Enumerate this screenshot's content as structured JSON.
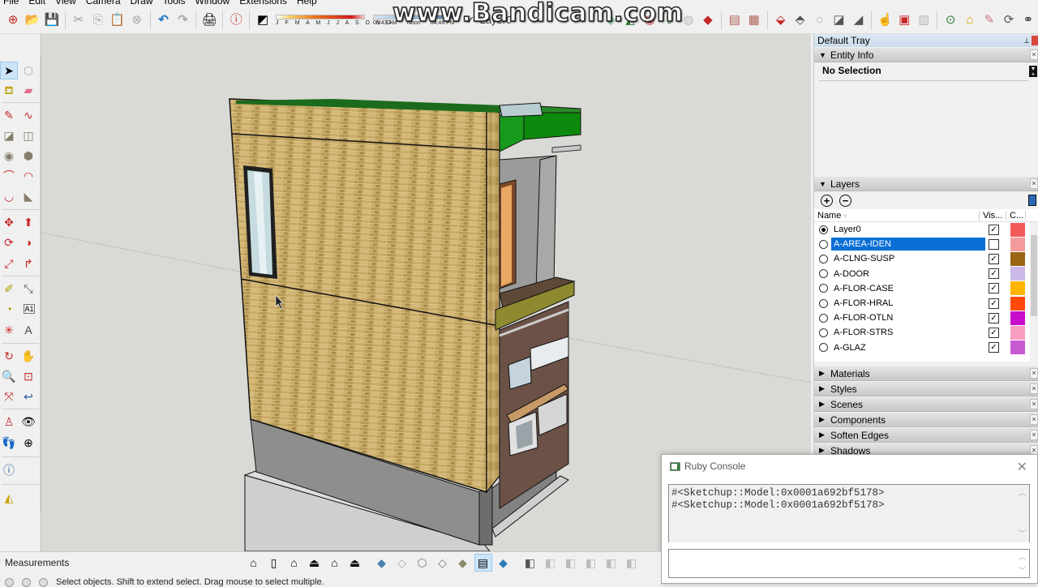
{
  "menu": [
    "File",
    "Edit",
    "View",
    "Camera",
    "Draw",
    "Tools",
    "Window",
    "Extensions",
    "Help"
  ],
  "watermark": "www.Bandicam.com",
  "toolbar": {
    "icons": [
      "new-file",
      "open-file",
      "save",
      "cut",
      "copy",
      "paste",
      "erase",
      "undo",
      "redo",
      "print",
      "model-info",
      "shadows"
    ],
    "shadow_months": "J F M A M J J A S O N D",
    "shadow_times": [
      "06:43 AM",
      "Noon",
      "04:46 PM"
    ],
    "current_layer": "Layer0",
    "right_icons": [
      "sandbox-from-contours",
      "sandbox-from-scratch",
      "smoove",
      "stamp",
      "drape",
      "add-detail",
      "flip-edge",
      "interact",
      "dynamic-components-options",
      "dynamic-components-attributes",
      "3d-warehouse",
      "share-model",
      "extension-warehouse",
      "extension-manager",
      "preview-google-earth"
    ]
  },
  "left_toolbar": {
    "tools": [
      "select",
      "make-component",
      "paint-bucket",
      "eraser",
      "line",
      "freehand",
      "rectangle",
      "rotated-rectangle",
      "circle",
      "polygon",
      "arc",
      "three-point-arc",
      "two-point-arc",
      "pie",
      "move",
      "push-pull",
      "rotate",
      "follow-me",
      "scale",
      "offset",
      "tape-measure",
      "dimension",
      "protractor",
      "text",
      "axes",
      "3d-text",
      "orbit",
      "pan",
      "zoom",
      "zoom-window",
      "zoom-extents",
      "previous-view",
      "position-camera",
      "look-around",
      "walk",
      "section-plane",
      "model-info",
      "mirror"
    ]
  },
  "tray": {
    "title": "Default Tray",
    "entity_info": {
      "label": "Entity Info",
      "status": "No Selection"
    },
    "layers": {
      "label": "Layers",
      "columns": [
        "Name",
        "Vis...",
        "C..."
      ],
      "rows": [
        {
          "name": "Layer0",
          "active": true,
          "visible": true,
          "color": "#f25a5a",
          "selected": false
        },
        {
          "name": "A-AREA-IDEN",
          "active": false,
          "visible": false,
          "color": "#f59a9a",
          "selected": true
        },
        {
          "name": "A-CLNG-SUSP",
          "active": false,
          "visible": true,
          "color": "#9a6414",
          "selected": false
        },
        {
          "name": "A-DOOR",
          "active": false,
          "visible": true,
          "color": "#c9b8e8",
          "selected": false
        },
        {
          "name": "A-FLOR-CASE",
          "active": false,
          "visible": true,
          "color": "#ffb400",
          "selected": false
        },
        {
          "name": "A-FLOR-HRAL",
          "active": false,
          "visible": true,
          "color": "#ff4a0a",
          "selected": false
        },
        {
          "name": "A-FLOR-OTLN",
          "active": false,
          "visible": true,
          "color": "#c80ccc",
          "selected": false
        },
        {
          "name": "A-FLOR-STRS",
          "active": false,
          "visible": true,
          "color": "#f79ec0",
          "selected": false
        },
        {
          "name": "A-GLAZ",
          "active": false,
          "visible": true,
          "color": "#c85ad2",
          "selected": false
        }
      ]
    },
    "collapsed_panels": [
      "Materials",
      "Styles",
      "Scenes",
      "Components",
      "Soften Edges",
      "Shadows"
    ]
  },
  "ruby_console": {
    "title": "Ruby Console",
    "output": [
      "#<Sketchup::Model:0x0001a692bf5178>",
      "#<Sketchup::Model:0x0001a692bf5178>"
    ],
    "input": ""
  },
  "status": {
    "measurements_label": "Measurements",
    "hint": "Select objects. Shift to extend select. Drag mouse to select multiple.",
    "view_icons": [
      "iso",
      "top",
      "front",
      "right",
      "back",
      "left",
      "x-ray",
      "back-edges",
      "wireframe",
      "hidden-line",
      "shaded",
      "shaded-with-textures",
      "monochrome",
      "outer-shell",
      "union",
      "subtract",
      "intersect",
      "trim",
      "split"
    ]
  }
}
